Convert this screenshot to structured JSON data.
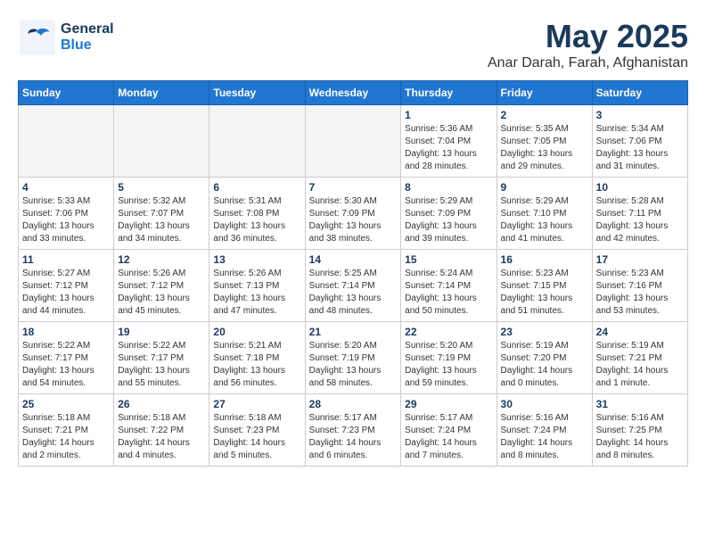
{
  "header": {
    "logo_general": "General",
    "logo_blue": "Blue",
    "title": "May 2025",
    "subtitle": "Anar Darah, Farah, Afghanistan"
  },
  "calendar": {
    "days_of_week": [
      "Sunday",
      "Monday",
      "Tuesday",
      "Wednesday",
      "Thursday",
      "Friday",
      "Saturday"
    ],
    "weeks": [
      [
        {
          "day": "",
          "detail": ""
        },
        {
          "day": "",
          "detail": ""
        },
        {
          "day": "",
          "detail": ""
        },
        {
          "day": "",
          "detail": ""
        },
        {
          "day": "1",
          "detail": "Sunrise: 5:36 AM\nSunset: 7:04 PM\nDaylight: 13 hours\nand 28 minutes."
        },
        {
          "day": "2",
          "detail": "Sunrise: 5:35 AM\nSunset: 7:05 PM\nDaylight: 13 hours\nand 29 minutes."
        },
        {
          "day": "3",
          "detail": "Sunrise: 5:34 AM\nSunset: 7:06 PM\nDaylight: 13 hours\nand 31 minutes."
        }
      ],
      [
        {
          "day": "4",
          "detail": "Sunrise: 5:33 AM\nSunset: 7:06 PM\nDaylight: 13 hours\nand 33 minutes."
        },
        {
          "day": "5",
          "detail": "Sunrise: 5:32 AM\nSunset: 7:07 PM\nDaylight: 13 hours\nand 34 minutes."
        },
        {
          "day": "6",
          "detail": "Sunrise: 5:31 AM\nSunset: 7:08 PM\nDaylight: 13 hours\nand 36 minutes."
        },
        {
          "day": "7",
          "detail": "Sunrise: 5:30 AM\nSunset: 7:09 PM\nDaylight: 13 hours\nand 38 minutes."
        },
        {
          "day": "8",
          "detail": "Sunrise: 5:29 AM\nSunset: 7:09 PM\nDaylight: 13 hours\nand 39 minutes."
        },
        {
          "day": "9",
          "detail": "Sunrise: 5:29 AM\nSunset: 7:10 PM\nDaylight: 13 hours\nand 41 minutes."
        },
        {
          "day": "10",
          "detail": "Sunrise: 5:28 AM\nSunset: 7:11 PM\nDaylight: 13 hours\nand 42 minutes."
        }
      ],
      [
        {
          "day": "11",
          "detail": "Sunrise: 5:27 AM\nSunset: 7:12 PM\nDaylight: 13 hours\nand 44 minutes."
        },
        {
          "day": "12",
          "detail": "Sunrise: 5:26 AM\nSunset: 7:12 PM\nDaylight: 13 hours\nand 45 minutes."
        },
        {
          "day": "13",
          "detail": "Sunrise: 5:26 AM\nSunset: 7:13 PM\nDaylight: 13 hours\nand 47 minutes."
        },
        {
          "day": "14",
          "detail": "Sunrise: 5:25 AM\nSunset: 7:14 PM\nDaylight: 13 hours\nand 48 minutes."
        },
        {
          "day": "15",
          "detail": "Sunrise: 5:24 AM\nSunset: 7:14 PM\nDaylight: 13 hours\nand 50 minutes."
        },
        {
          "day": "16",
          "detail": "Sunrise: 5:23 AM\nSunset: 7:15 PM\nDaylight: 13 hours\nand 51 minutes."
        },
        {
          "day": "17",
          "detail": "Sunrise: 5:23 AM\nSunset: 7:16 PM\nDaylight: 13 hours\nand 53 minutes."
        }
      ],
      [
        {
          "day": "18",
          "detail": "Sunrise: 5:22 AM\nSunset: 7:17 PM\nDaylight: 13 hours\nand 54 minutes."
        },
        {
          "day": "19",
          "detail": "Sunrise: 5:22 AM\nSunset: 7:17 PM\nDaylight: 13 hours\nand 55 minutes."
        },
        {
          "day": "20",
          "detail": "Sunrise: 5:21 AM\nSunset: 7:18 PM\nDaylight: 13 hours\nand 56 minutes."
        },
        {
          "day": "21",
          "detail": "Sunrise: 5:20 AM\nSunset: 7:19 PM\nDaylight: 13 hours\nand 58 minutes."
        },
        {
          "day": "22",
          "detail": "Sunrise: 5:20 AM\nSunset: 7:19 PM\nDaylight: 13 hours\nand 59 minutes."
        },
        {
          "day": "23",
          "detail": "Sunrise: 5:19 AM\nSunset: 7:20 PM\nDaylight: 14 hours\nand 0 minutes."
        },
        {
          "day": "24",
          "detail": "Sunrise: 5:19 AM\nSunset: 7:21 PM\nDaylight: 14 hours\nand 1 minute."
        }
      ],
      [
        {
          "day": "25",
          "detail": "Sunrise: 5:18 AM\nSunset: 7:21 PM\nDaylight: 14 hours\nand 2 minutes."
        },
        {
          "day": "26",
          "detail": "Sunrise: 5:18 AM\nSunset: 7:22 PM\nDaylight: 14 hours\nand 4 minutes."
        },
        {
          "day": "27",
          "detail": "Sunrise: 5:18 AM\nSunset: 7:23 PM\nDaylight: 14 hours\nand 5 minutes."
        },
        {
          "day": "28",
          "detail": "Sunrise: 5:17 AM\nSunset: 7:23 PM\nDaylight: 14 hours\nand 6 minutes."
        },
        {
          "day": "29",
          "detail": "Sunrise: 5:17 AM\nSunset: 7:24 PM\nDaylight: 14 hours\nand 7 minutes."
        },
        {
          "day": "30",
          "detail": "Sunrise: 5:16 AM\nSunset: 7:24 PM\nDaylight: 14 hours\nand 8 minutes."
        },
        {
          "day": "31",
          "detail": "Sunrise: 5:16 AM\nSunset: 7:25 PM\nDaylight: 14 hours\nand 8 minutes."
        }
      ]
    ]
  }
}
